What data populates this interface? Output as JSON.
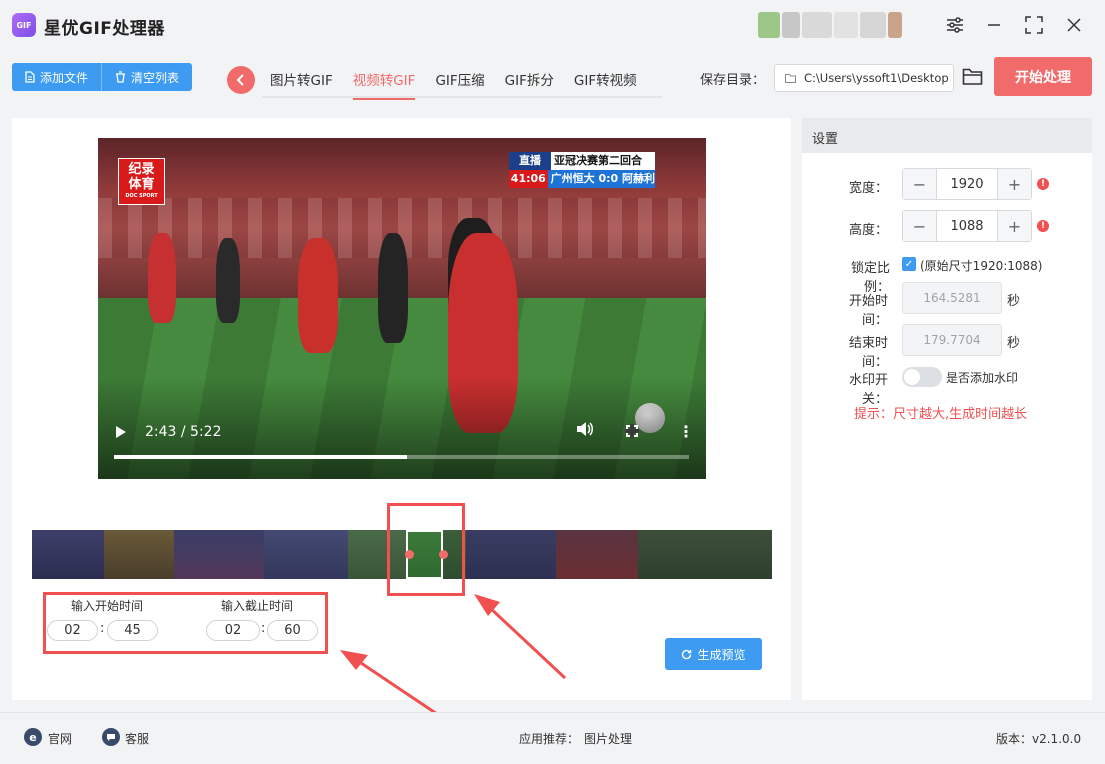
{
  "app": {
    "title": "星优GIF处理器",
    "logo_text": "GIF"
  },
  "toolbar": {
    "add_file": "添加文件",
    "clear_list": "清空列表",
    "save_dir_label": "保存目录：",
    "save_path": "C:\\Users\\yssoft1\\Desktop",
    "start_button": "开始处理"
  },
  "tabs": [
    {
      "label": "图片转GIF",
      "active": false
    },
    {
      "label": "视频转GIF",
      "active": true
    },
    {
      "label": "GIF压缩",
      "active": false
    },
    {
      "label": "GIF拆分",
      "active": false
    },
    {
      "label": "GIF转视频",
      "active": false
    }
  ],
  "video": {
    "logo_line1": "纪录",
    "logo_line2": "体育",
    "logo_sub": "DOC SPORT",
    "live_tag": "直播",
    "match_title": "亚冠决赛第二回合",
    "match_clock": "41:06",
    "match_teams": "广州恒大 0:0 阿赫利",
    "time_display": "2:43 / 5:22",
    "progress": 0.51
  },
  "trim": {
    "start_label": "输入开始时间",
    "end_label": "输入截止时间",
    "start_min": "02",
    "start_sec": "45",
    "end_min": "02",
    "end_sec": "60",
    "colon": ":",
    "preview_button": "生成预览"
  },
  "settings": {
    "header": "设置",
    "width_label": "宽度：",
    "width_value": "1920",
    "height_label": "高度：",
    "height_value": "1088",
    "lock_label": "锁定比例：",
    "lock_text": "(原始尺寸1920:1088)",
    "start_label": "开始时间：",
    "start_value": "164.5281",
    "end_label": "结束时间：",
    "end_value": "179.7704",
    "unit": "秒",
    "watermark_label": "水印开关：",
    "watermark_text": "是否添加水印",
    "hint": "提示：尺寸越大,生成时间越长"
  },
  "statusbar": {
    "website": "官网",
    "support": "客服",
    "recommend_label": "应用推荐：",
    "recommend_app": "图片处理",
    "version": "版本：v2.1.0.0"
  },
  "colors": {
    "accent_red": "#f26b6b",
    "accent_blue": "#3d9bf2",
    "warning_red": "#f05050"
  }
}
